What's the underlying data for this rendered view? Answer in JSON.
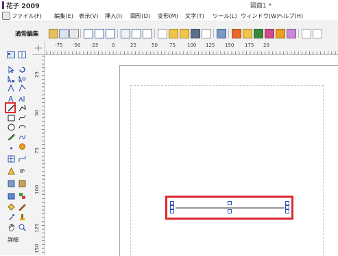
{
  "titlebar": {
    "app_title": "花子 2009",
    "document_title": "図面1 *"
  },
  "menubar": [
    {
      "id": "file",
      "label": "ファイル(F)"
    },
    {
      "id": "edit",
      "label": "編集(E)"
    },
    {
      "id": "view",
      "label": "表示(V)"
    },
    {
      "id": "insert",
      "label": "挿入(I)"
    },
    {
      "id": "shape",
      "label": "図形(D)"
    },
    {
      "id": "transform",
      "label": "変形(M)"
    },
    {
      "id": "text",
      "label": "文字(T)"
    },
    {
      "id": "tools",
      "label": "ツール(L)"
    },
    {
      "id": "window",
      "label": "ウィンドウ(W)"
    },
    {
      "id": "help",
      "label": "ヘルプ(H)"
    }
  ],
  "toolbar": {
    "mode_label": "通常編集"
  },
  "left_panel": {
    "detail_label": "詳細"
  },
  "rulers": {
    "horizontal_labels": [
      "-75",
      "-50",
      "-25",
      "0",
      "25",
      "50",
      "75",
      "100",
      "125",
      "150",
      "175",
      "20"
    ],
    "vertical_labels": [
      "25",
      "50",
      "75",
      "100",
      "125",
      "150"
    ]
  },
  "colors": {
    "highlight": "#e0262e",
    "selection_handle": "#2a4fb8",
    "title_accent": "#5a2a7a"
  }
}
